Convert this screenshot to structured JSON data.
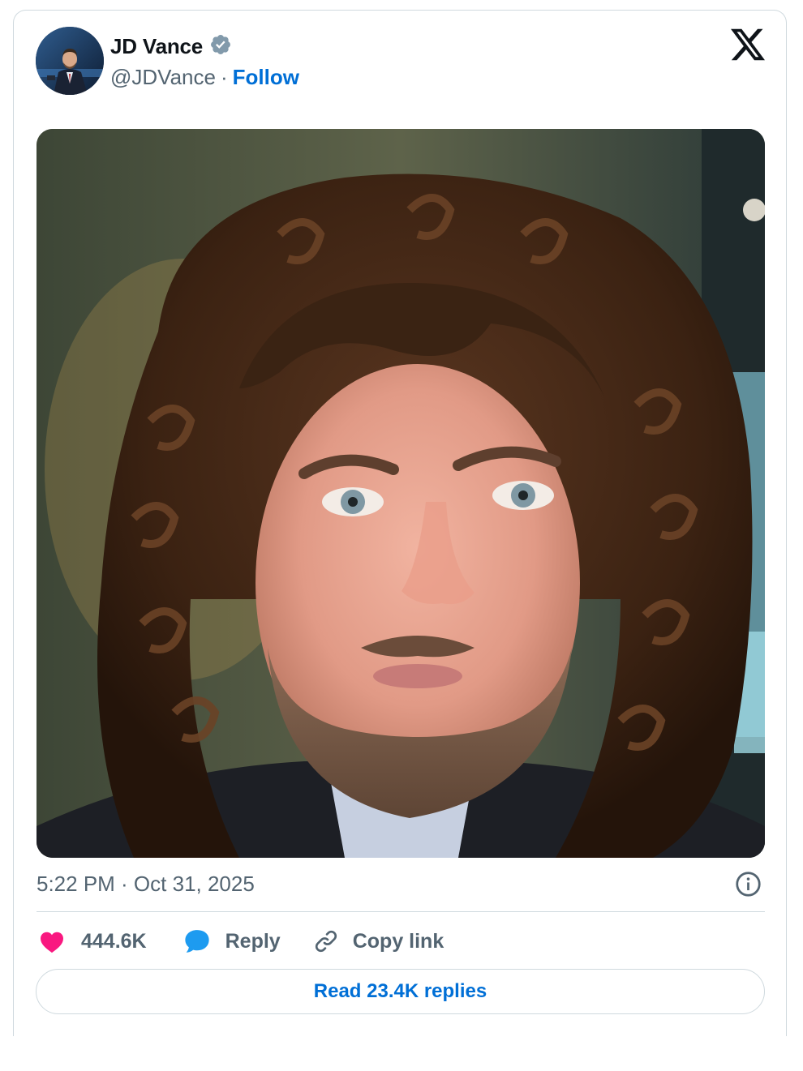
{
  "author": {
    "display_name": "JD Vance",
    "handle": "@JDVance",
    "separator": "·",
    "follow_label": "Follow",
    "verified_badge": "verified-badge-icon",
    "avatar": "author-avatar-photo"
  },
  "brand": {
    "logo": "x-logo-icon"
  },
  "tweet": {
    "media": "selfie-photo-curly-wig",
    "timestamp": "5:22 PM · Oct 31, 2025",
    "info_icon": "info-icon"
  },
  "actions": {
    "like_count": "444.6K",
    "like_icon": "heart-icon",
    "reply_label": "Reply",
    "reply_icon": "speech-bubble-icon",
    "copy_label": "Copy link",
    "copy_icon": "link-icon"
  },
  "footer": {
    "read_replies_label": "Read 23.4K replies"
  },
  "colors": {
    "link_blue": "#006fd6",
    "heart_pink": "#f91880",
    "reply_blue": "#1d9bf0",
    "muted_text": "#536471",
    "border": "#cfd9de",
    "verified_badge": "#829aab"
  }
}
